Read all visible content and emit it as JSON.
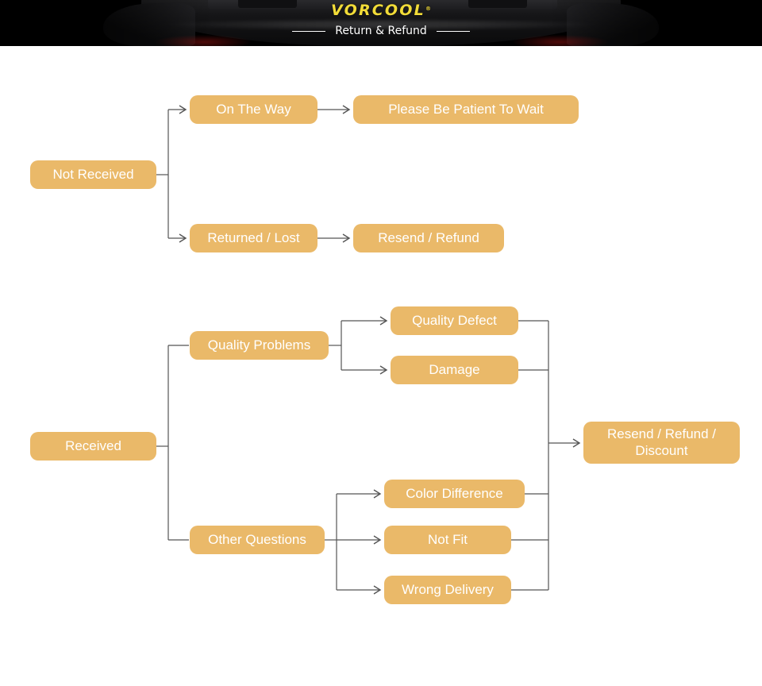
{
  "banner": {
    "brand_name": "VORCOOL",
    "brand_mark": "®",
    "subtitle": "Return & Refund",
    "background_color": "#000000",
    "brand_color": "#f2dc38",
    "subtitle_color": "#ffffff"
  },
  "theme": {
    "node_fill": "#eab969",
    "node_text": "#ffffff",
    "connector_color": "#555555",
    "page_background": "#ffffff"
  },
  "chart_data": {
    "type": "diagram",
    "title": "Return & Refund",
    "diagram_kind": "flowchart",
    "direction": "left-to-right",
    "flows": [
      {
        "id": "not-received",
        "root": "Not Received",
        "branches": [
          {
            "condition": "On The Way",
            "outcome": "Please Be Patient To Wait"
          },
          {
            "condition": "Returned / Lost",
            "outcome": "Resend / Refund"
          }
        ]
      },
      {
        "id": "received",
        "root": "Received",
        "branches": [
          {
            "condition": "Quality Problems",
            "reasons": [
              "Quality Defect",
              "Damage"
            ]
          },
          {
            "condition": "Other Questions",
            "reasons": [
              "Color Difference",
              "Not Fit",
              "Wrong Delivery"
            ]
          }
        ],
        "outcome": "Resend / Refund /\nDiscount"
      }
    ]
  },
  "nodes": {
    "not_received": "Not Received",
    "on_the_way": "On The Way",
    "please_be_patient": "Please Be Patient To Wait",
    "returned_lost": "Returned / Lost",
    "resend_refund": "Resend / Refund",
    "received": "Received",
    "quality_problems": "Quality Problems",
    "quality_defect": "Quality Defect",
    "damage": "Damage",
    "other_questions": "Other Questions",
    "color_difference": "Color Difference",
    "not_fit": "Not Fit",
    "wrong_delivery": "Wrong Delivery",
    "resend_refund_discount": "Resend / Refund /\nDiscount"
  }
}
